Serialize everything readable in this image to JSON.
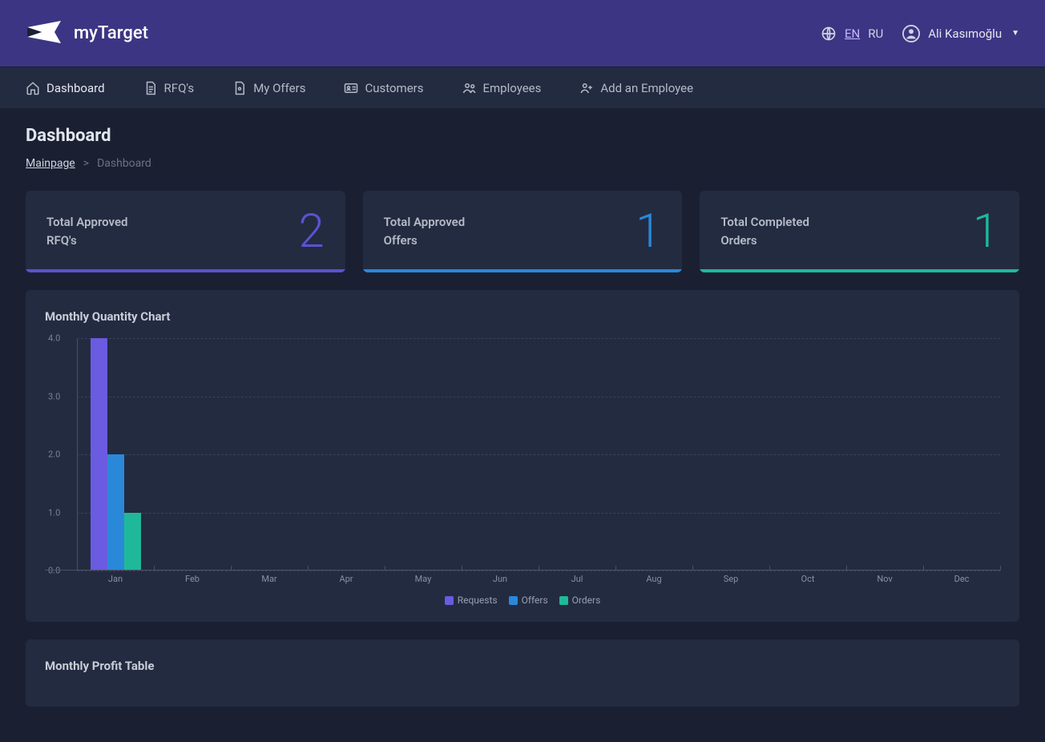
{
  "brand": {
    "name": "myTarget"
  },
  "lang": {
    "en": "EN",
    "ru": "RU"
  },
  "user": {
    "name": "Ali Kasımoğlu"
  },
  "nav": {
    "dashboard": "Dashboard",
    "rfqs": "RFQ's",
    "my_offers": "My Offers",
    "customers": "Customers",
    "employees": "Employees",
    "add_employee": "Add an Employee"
  },
  "page": {
    "title": "Dashboard",
    "breadcrumb": {
      "home": "Mainpage",
      "current": "Dashboard"
    }
  },
  "stats": [
    {
      "label_l1": "Total Approved",
      "label_l2": "RFQ's",
      "value": "2"
    },
    {
      "label_l1": "Total Approved",
      "label_l2": "Offers",
      "value": "1"
    },
    {
      "label_l1": "Total Completed",
      "label_l2": "Orders",
      "value": "1"
    }
  ],
  "chart_panel_title": "Monthly Quantity Chart",
  "profit_panel_title": "Monthly Profit Table",
  "chart_data": {
    "type": "bar",
    "title": "Monthly Quantity Chart",
    "xlabel": "",
    "ylabel": "",
    "ylim": [
      0,
      4
    ],
    "categories": [
      "Jan",
      "Feb",
      "Mar",
      "Apr",
      "May",
      "Jun",
      "Jul",
      "Aug",
      "Sep",
      "Oct",
      "Nov",
      "Dec"
    ],
    "series": [
      {
        "name": "Requests",
        "values": [
          4,
          0,
          0,
          0,
          0,
          0,
          0,
          0,
          0,
          0,
          0,
          0
        ],
        "color": "#6a5be0"
      },
      {
        "name": "Offers",
        "values": [
          2,
          0,
          0,
          0,
          0,
          0,
          0,
          0,
          0,
          0,
          0,
          0
        ],
        "color": "#2a88d9"
      },
      {
        "name": "Orders",
        "values": [
          1,
          0,
          0,
          0,
          0,
          0,
          0,
          0,
          0,
          0,
          0,
          0
        ],
        "color": "#1fb999"
      }
    ],
    "y_ticks": [
      "4.0",
      "3.0",
      "2.0",
      "1.0",
      "0.0"
    ]
  }
}
